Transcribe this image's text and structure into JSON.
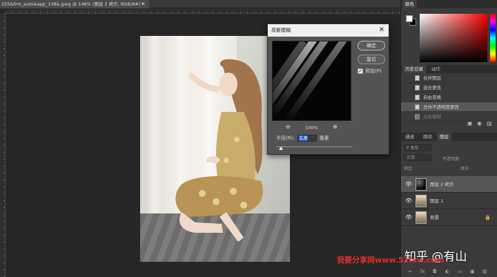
{
  "document": {
    "tab_title": "255&fmt_auto&app_138&.jpeg @ 146% (图层 2 拷贝, RGB/8#) *",
    "close_glyph": "×"
  },
  "gaussian_blur": {
    "title": "高斯模糊",
    "ok_label": "确定",
    "reset_label": "复位",
    "preview_label": "预览(P)",
    "preview_checked": true,
    "zoom_level": "100%",
    "radius_label": "半径(R):",
    "radius_value": "1.8",
    "radius_unit": "像素"
  },
  "panels": {
    "color_tab": "颜色",
    "history_tabs": [
      "历史记录",
      "动作"
    ],
    "history_items": [
      {
        "label": "合并图层",
        "state": "normal"
      },
      {
        "label": "混合更改",
        "state": "normal"
      },
      {
        "label": "自由变换",
        "state": "normal"
      },
      {
        "label": "总体不透明度更改",
        "state": "selected"
      },
      {
        "label": "高斯模糊",
        "state": "undone"
      }
    ],
    "layers_tabs": [
      "通道",
      "路径",
      "图层"
    ],
    "layers_filter": "P 类型",
    "blend_mode": "正常",
    "opacity_label": "不透明度:",
    "lock_label": "锁定:",
    "fill_label": "填充:",
    "layers": [
      {
        "name": "图层 2 拷贝",
        "thumb": "blur",
        "selected": true,
        "locked": false
      },
      {
        "name": "图层 1",
        "thumb": "photo",
        "selected": false,
        "locked": false
      },
      {
        "name": "背景",
        "thumb": "photo",
        "selected": false,
        "locked": true
      }
    ]
  },
  "watermark": {
    "zhihu": "知乎 @有山",
    "site": "我要分享网www.51fxw.com"
  },
  "colors": {
    "accent_selection": "#2f6fd1",
    "watermark_red": "#e0312d"
  }
}
